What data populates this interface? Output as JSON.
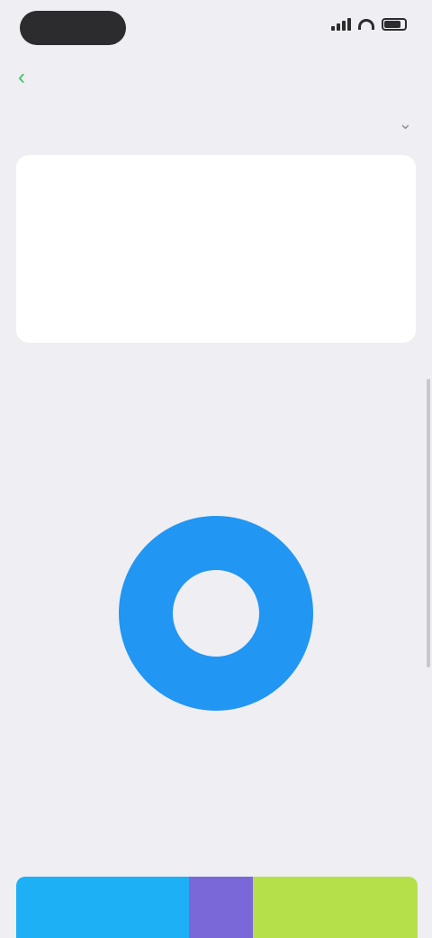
{
  "status_bar": {
    "time": "",
    "signal_bars": 4
  },
  "nav": {
    "back_label": "",
    "title": ""
  },
  "section": {
    "title": ""
  },
  "card": {
    "label": "",
    "metrics": [
      {
        "value": "",
        "caption": ""
      },
      {
        "value": "",
        "caption": ""
      },
      {
        "value": "",
        "caption": ""
      },
      {
        "value": "",
        "caption": ""
      }
    ]
  },
  "footnote": {
    "text": "",
    "link": ""
  },
  "chart_title": "",
  "chart_data": {
    "type": "pie",
    "donut": true,
    "slices": [
      {
        "value": 100,
        "color": "#2196f3"
      }
    ],
    "center_text": "",
    "outer_label": ""
  },
  "bottom": {
    "title": "",
    "column_labels": [
      "",
      "",
      ""
    ],
    "segments": [
      {
        "share": 0.43,
        "color": "#1eb0f5"
      },
      {
        "share": 0.16,
        "color": "#7a68d8"
      },
      {
        "share": 0.41,
        "color": "#b6e04a"
      }
    ]
  },
  "colors": {
    "accent": "#34c759",
    "background": "#eeeef3"
  }
}
